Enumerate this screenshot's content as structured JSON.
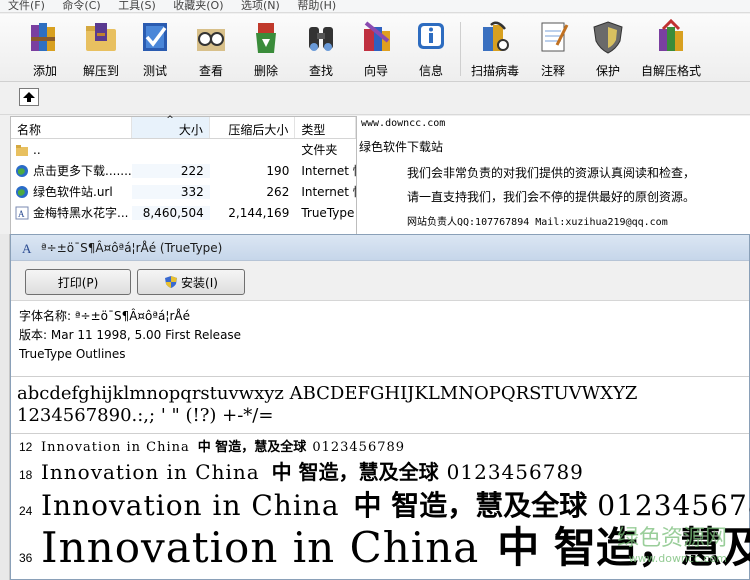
{
  "menu": [
    "文件(F)",
    "命令(C)",
    "工具(S)",
    "收藏夹(O)",
    "选项(N)",
    "帮助(H)"
  ],
  "toolbar": [
    {
      "label": "添加",
      "icon": "books-add-icon"
    },
    {
      "label": "解压到",
      "icon": "folder-extract-icon"
    },
    {
      "label": "测试",
      "icon": "check-book-icon"
    },
    {
      "label": "查看",
      "icon": "glasses-icon"
    },
    {
      "label": "删除",
      "icon": "recycle-bin-icon"
    },
    {
      "label": "查找",
      "icon": "binoculars-icon"
    },
    {
      "label": "向导",
      "icon": "wizard-icon"
    },
    {
      "label": "信息",
      "icon": "info-icon"
    },
    {
      "label": "扫描病毒",
      "icon": "virus-scan-icon"
    },
    {
      "label": "注释",
      "icon": "notepad-icon"
    },
    {
      "label": "保护",
      "icon": "shield-icon"
    },
    {
      "label": "自解压格式",
      "icon": "sfx-icon"
    }
  ],
  "filelist": {
    "headers": {
      "name": "名称",
      "size": "大小",
      "packed": "压缩后大小",
      "type": "类型"
    },
    "rows": [
      {
        "name": "..",
        "size": "",
        "packed": "",
        "type": "文件夹",
        "icon": "folder-icon"
      },
      {
        "name": "点击更多下载.......",
        "size": "222",
        "packed": "190",
        "type": "Internet 快",
        "icon": "globe-icon"
      },
      {
        "name": "绿色软件站.url",
        "size": "332",
        "packed": "262",
        "type": "Internet 快",
        "icon": "globe-icon"
      },
      {
        "name": "金梅特黑水花字...",
        "size": "8,460,504",
        "packed": "2,144,169",
        "type": "TrueType",
        "icon": "font-file-icon"
      }
    ]
  },
  "comment": {
    "url": "www.downcc.com",
    "site": "绿色软件下载站",
    "line1": "我们会非常负责的对我们提供的资源认真阅读和检查，",
    "line2": "请一直支持我们，我们会不停的提供最好的原创资源。",
    "line3": "网站负责人QQ:107767894  Mail:xuzihua219@qq.com"
  },
  "fontviewer": {
    "title": "ª÷±ö¯S¶Â¤ôªá¦rÅé (TrueType)",
    "print_label": "打印(P)",
    "install_label": "安装(I)",
    "font_name": "字体名称: ª÷±ö¯S¶Â¤ôªá¦rÅé",
    "version": "版本: Mar 11 1998, 5.00 First Release",
    "outlines": "TrueType Outlines",
    "chars_line1": "abcdefghijklmnopqrstuvwxyz ABCDEFGHIJKLMNOPQRSTUVWXYZ",
    "chars_line2": "1234567890.:,; ' \" (!?) +-*/=",
    "sample_latin": "Innovation in China",
    "sample_cjk": "中  智造，慧及全球",
    "sample_digits": "0123456789",
    "sizes": [
      "12",
      "18",
      "24",
      "36"
    ]
  },
  "watermark": {
    "text": "绿色资源网",
    "url": "www.downcc.com"
  }
}
